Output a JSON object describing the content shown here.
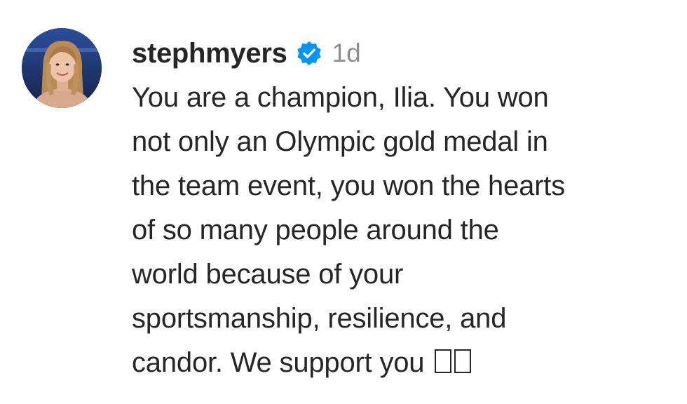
{
  "comment": {
    "username": "stephmyers",
    "verified_icon": "verified-badge-icon",
    "time": "1d",
    "text": "You are a champion, Ilia. You won\nnot only an Olympic gold medal in\nthe team event, you won the hearts\nof so many people around the\nworld because of your\nsportsmanship, resilience, and\ncandor. We support you ",
    "emoji_placeholders": [
      "missing-glyph-box",
      "missing-glyph-box"
    ],
    "colors": {
      "username": "#262626",
      "text": "#262626",
      "time": "#8e8e8e",
      "verified": "#0095f6"
    }
  }
}
